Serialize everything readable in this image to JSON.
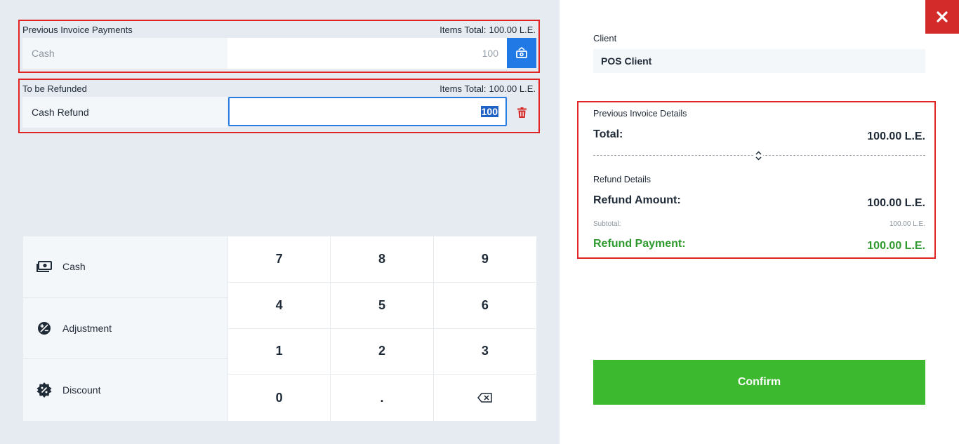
{
  "previous_payments": {
    "title": "Previous Invoice Payments",
    "items_total_label": "Items Total:",
    "items_total_value": "100.00 L.E.",
    "method": "Cash",
    "amount": "100"
  },
  "to_refund": {
    "title": "To be Refunded",
    "items_total_label": "Items Total:",
    "items_total_value": "100.00 L.E.",
    "method": "Cash Refund",
    "amount": "100"
  },
  "methods": [
    {
      "label": "Cash",
      "icon": "cash-icon"
    },
    {
      "label": "Adjustment",
      "icon": "adjustment-icon"
    },
    {
      "label": "Discount",
      "icon": "discount-icon"
    }
  ],
  "keypad": [
    "7",
    "8",
    "9",
    "4",
    "5",
    "6",
    "1",
    "2",
    "3",
    "0",
    ".",
    "backspace"
  ],
  "client": {
    "label": "Client",
    "value": "POS Client"
  },
  "invoice_details": {
    "title": "Previous Invoice Details",
    "total_label": "Total:",
    "total_value": "100.00 L.E.",
    "refund_title": "Refund Details",
    "refund_amount_label": "Refund Amount:",
    "refund_amount_value": "100.00 L.E.",
    "subtotal_label": "Subtotal:",
    "subtotal_value": "100.00 L.E.",
    "refund_payment_label": "Refund Payment:",
    "refund_payment_value": "100.00 L.E."
  },
  "confirm_label": "Confirm",
  "colors": {
    "accent_blue": "#2179e6",
    "danger_red": "#d32a2a",
    "success_green": "#3db92f"
  }
}
